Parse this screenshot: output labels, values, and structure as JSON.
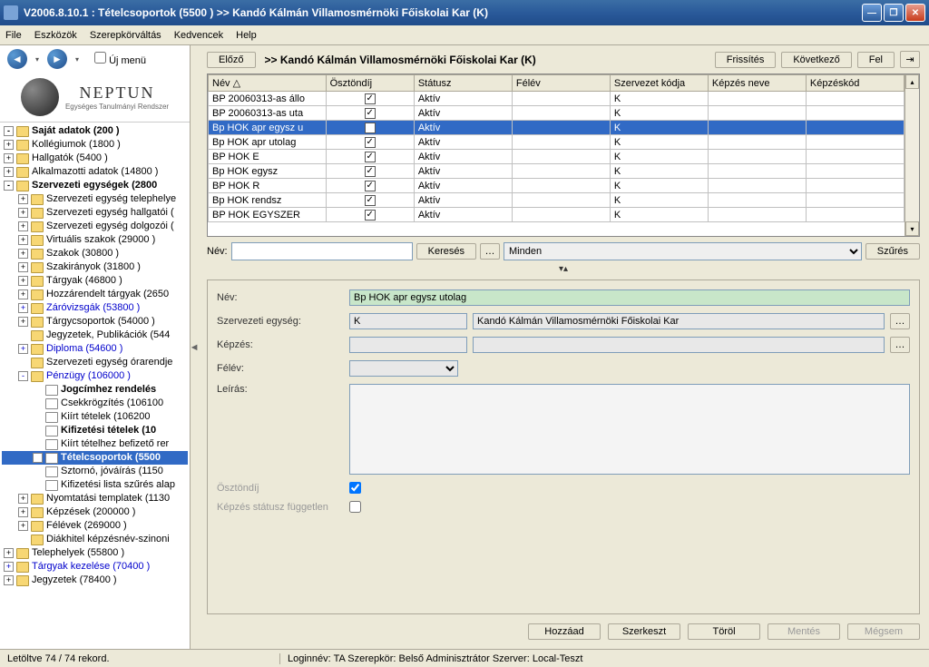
{
  "window": {
    "title": "V2006.8.10.1 : Tételcsoportok (5500  )   >> Kandó Kálmán Villamosmérnöki Főiskolai Kar (K)"
  },
  "menu": {
    "file": "File",
    "eszkozok": "Eszközök",
    "szerepkorvaltas": "Szerepkörváltás",
    "kedvencek": "Kedvencek",
    "help": "Help"
  },
  "nav": {
    "ujmenu_label": "Új menü"
  },
  "logo": {
    "main": "NEPTUN",
    "sub": "Egységes Tanulmányi Rendszer"
  },
  "tree": [
    {
      "indent": 0,
      "toggle": "-",
      "bold": true,
      "label": "Saját adatok (200  )"
    },
    {
      "indent": 0,
      "toggle": "+",
      "label": "Kollégiumok (1800  )"
    },
    {
      "indent": 0,
      "toggle": "+",
      "label": "Hallgatók (5400  )"
    },
    {
      "indent": 0,
      "toggle": "+",
      "label": "Alkalmazotti adatok (14800  )"
    },
    {
      "indent": 0,
      "toggle": "-",
      "bold": true,
      "label": "Szervezeti egységek (2800"
    },
    {
      "indent": 1,
      "toggle": "+",
      "label": "Szervezeti egység telephelye"
    },
    {
      "indent": 1,
      "toggle": "+",
      "label": "Szervezeti egység hallgatói ("
    },
    {
      "indent": 1,
      "toggle": "+",
      "label": "Szervezeti egység dolgozói ("
    },
    {
      "indent": 1,
      "toggle": "+",
      "label": "Virtuális szakok (29000  )"
    },
    {
      "indent": 1,
      "toggle": "+",
      "label": "Szakok (30800  )"
    },
    {
      "indent": 1,
      "toggle": "+",
      "label": "Szakirányok (31800  )"
    },
    {
      "indent": 1,
      "toggle": "+",
      "label": "Tárgyak (46800  )"
    },
    {
      "indent": 1,
      "toggle": "+",
      "label": "Hozzárendelt tárgyak (2650"
    },
    {
      "indent": 1,
      "toggle": "+",
      "blue": true,
      "label": "Záróvizsgák (53800  )"
    },
    {
      "indent": 1,
      "toggle": "+",
      "label": "Tárgycsoportok (54000  )"
    },
    {
      "indent": 1,
      "toggle": "",
      "label": "Jegyzetek, Publikációk (544"
    },
    {
      "indent": 1,
      "toggle": "+",
      "blue": true,
      "label": "Diploma (54600  )"
    },
    {
      "indent": 1,
      "toggle": "",
      "label": "Szervezeti egység órarendje"
    },
    {
      "indent": 1,
      "toggle": "-",
      "blue": true,
      "label": "Pénzügy (106000  )"
    },
    {
      "indent": 2,
      "toggle": "",
      "doc": true,
      "bold": true,
      "label": "Jogcímhez rendelés"
    },
    {
      "indent": 2,
      "toggle": "",
      "doc": true,
      "label": "Csekkrögzítés (106100"
    },
    {
      "indent": 2,
      "toggle": "",
      "doc": true,
      "label": "Kiírt tételek (106200"
    },
    {
      "indent": 2,
      "toggle": "",
      "doc": true,
      "bold": true,
      "label": "Kifizetési tételek (10"
    },
    {
      "indent": 2,
      "toggle": "",
      "doc": true,
      "label": "Kiírt tételhez befizető rer"
    },
    {
      "indent": 2,
      "toggle": "+",
      "doc": true,
      "selected": true,
      "bold": true,
      "label": "Tételcsoportok (5500"
    },
    {
      "indent": 2,
      "toggle": "",
      "doc": true,
      "label": "Sztornó, jóváírás (1150"
    },
    {
      "indent": 2,
      "toggle": "",
      "doc": true,
      "label": "Kifizetési lista szűrés alap"
    },
    {
      "indent": 1,
      "toggle": "+",
      "label": "Nyomtatási templatek (1130"
    },
    {
      "indent": 1,
      "toggle": "+",
      "label": "Képzések (200000  )"
    },
    {
      "indent": 1,
      "toggle": "+",
      "label": "Félévek (269000  )"
    },
    {
      "indent": 1,
      "toggle": "",
      "label": "Diákhitel képzésnév-szinoni"
    },
    {
      "indent": 0,
      "toggle": "+",
      "label": "Telephelyek (55800  )"
    },
    {
      "indent": 0,
      "toggle": "+",
      "blue": true,
      "label": "Tárgyak kezelése (70400  )"
    },
    {
      "indent": 0,
      "toggle": "+",
      "label": "Jegyzetek (78400  )"
    }
  ],
  "breadcrumb": {
    "prev": "Előző",
    "title": ">>  Kandó Kálmán Villamosmérnöki Főiskolai Kar (K)",
    "refresh": "Frissítés",
    "next": "Következő",
    "up": "Fel"
  },
  "grid": {
    "columns": [
      "Név",
      "Ösztöndíj",
      "Státusz",
      "Félév",
      "Szervezet kódja",
      "Képzés neve",
      "Képzéskód"
    ],
    "rows": [
      {
        "cells": [
          "BP 20060313-as állo",
          "✓",
          "Aktív",
          "",
          "K",
          "",
          ""
        ],
        "selected": false
      },
      {
        "cells": [
          "BP 20060313-as uta",
          "✓",
          "Aktív",
          "",
          "K",
          "",
          ""
        ],
        "selected": false
      },
      {
        "cells": [
          "Bp HOK apr egysz u",
          "✓",
          "Aktív",
          "",
          "K",
          "",
          ""
        ],
        "selected": true
      },
      {
        "cells": [
          "Bp HOK apr utolag",
          "✓",
          "Aktív",
          "",
          "K",
          "",
          ""
        ],
        "selected": false
      },
      {
        "cells": [
          "BP HOK E",
          "✓",
          "Aktív",
          "",
          "K",
          "",
          ""
        ],
        "selected": false
      },
      {
        "cells": [
          "Bp HOK egysz",
          "✓",
          "Aktív",
          "",
          "K",
          "",
          ""
        ],
        "selected": false
      },
      {
        "cells": [
          "BP HOK R",
          "✓",
          "Aktív",
          "",
          "K",
          "",
          ""
        ],
        "selected": false
      },
      {
        "cells": [
          "Bp HOK rendsz",
          "✓",
          "Aktív",
          "",
          "K",
          "",
          ""
        ],
        "selected": false
      },
      {
        "cells": [
          "BP HOK  EGYSZER",
          "✓",
          "Aktív",
          "",
          "K",
          "",
          ""
        ],
        "selected": false
      }
    ]
  },
  "search": {
    "label": "Név:",
    "value": "",
    "search_btn": "Keresés",
    "filter_label": "Minden",
    "szures_btn": "Szűrés"
  },
  "form": {
    "nev_label": "Név:",
    "nev_value": "Bp HOK apr egysz utolag",
    "szerv_label": "Szervezeti egység:",
    "szerv_code": "K",
    "szerv_name": "Kandó Kálmán Villamosmérnöki Főiskolai Kar",
    "kepzes_label": "Képzés:",
    "felev_label": "Félév:",
    "leiras_label": "Leírás:",
    "osztondij_label": "Ösztöndíj",
    "osztondij_checked": true,
    "statusz_label": "Képzés státusz független"
  },
  "actions": {
    "hozzaad": "Hozzáad",
    "szerkeszt": "Szerkeszt",
    "torol": "Töröl",
    "mentes": "Mentés",
    "megsem": "Mégsem"
  },
  "status": {
    "left": "Letöltve 74 / 74 rekord.",
    "right": "Loginnév: TA  Szerepkör: Belső Adminisztrátor   Szerver: Local-Teszt"
  }
}
